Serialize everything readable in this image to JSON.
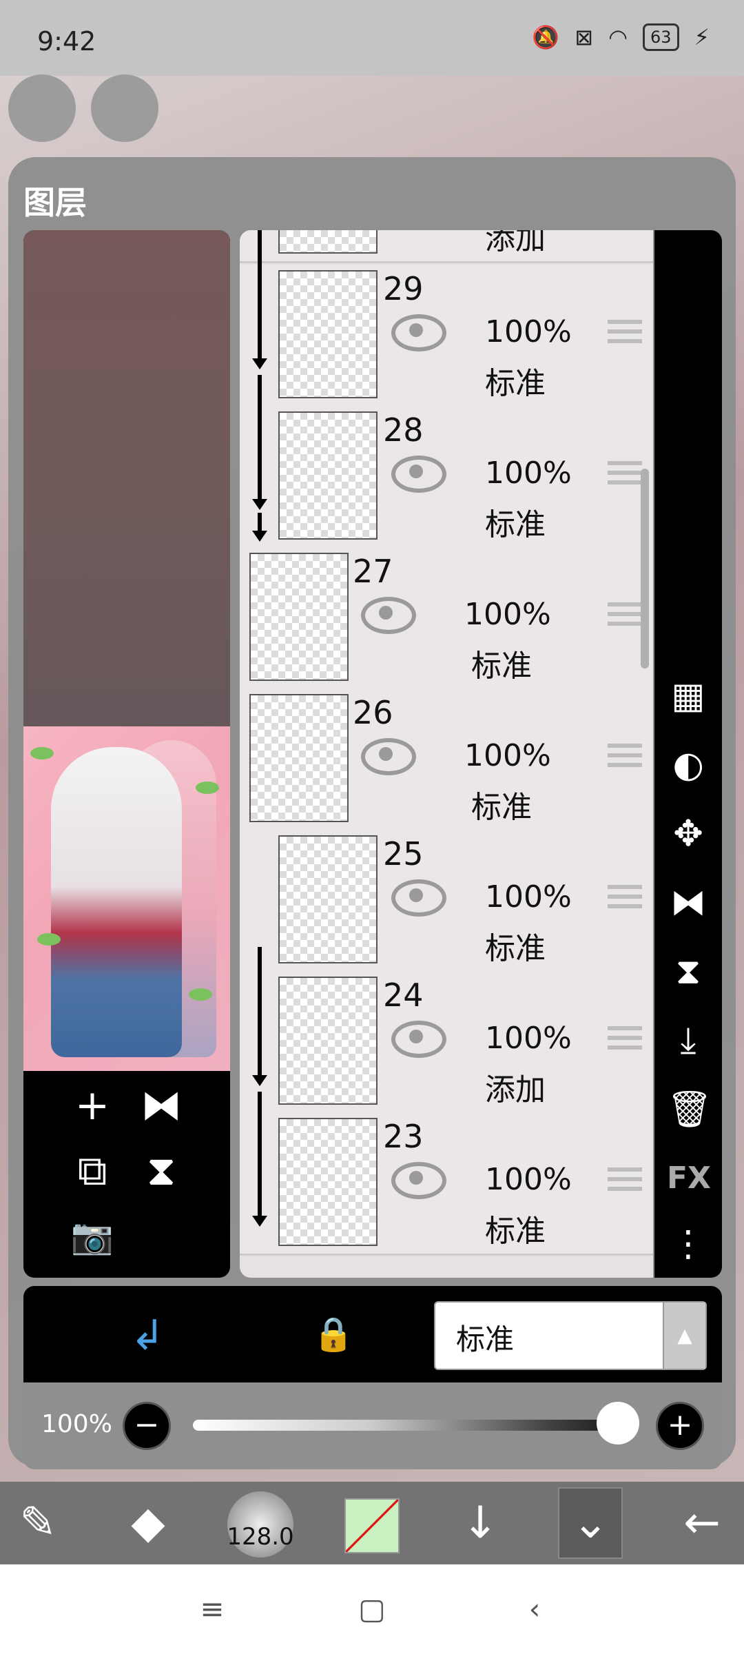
{
  "status_bar": {
    "time": "9:42",
    "battery": "63"
  },
  "panel": {
    "title": "图层"
  },
  "layers": [
    {
      "partial_blend": "添加"
    },
    {
      "number": "29",
      "opacity": "100%",
      "blend": "标准"
    },
    {
      "number": "28",
      "opacity": "100%",
      "blend": "标准"
    },
    {
      "number": "27",
      "opacity": "100%",
      "blend": "标准"
    },
    {
      "number": "26",
      "opacity": "100%",
      "blend": "标准"
    },
    {
      "number": "25",
      "opacity": "100%",
      "blend": "标准"
    },
    {
      "number": "24",
      "opacity": "100%",
      "blend": "添加"
    },
    {
      "number": "23",
      "opacity": "100%",
      "blend": "标准"
    }
  ],
  "right_toolbar": {
    "fx_label": "FX"
  },
  "blend_bar": {
    "blend_mode": "标准"
  },
  "opacity_bar": {
    "label": "100%",
    "value_percent": 100
  },
  "app_toolbar": {
    "brush_size": "128.0"
  },
  "icons": {
    "clip": "clip-icon",
    "lock": "alpha-lock-icon",
    "add": "plus-icon",
    "camera": "camera-icon"
  },
  "colors": {
    "accent": "#4aa3e6",
    "panel": "#8f8f8f"
  }
}
